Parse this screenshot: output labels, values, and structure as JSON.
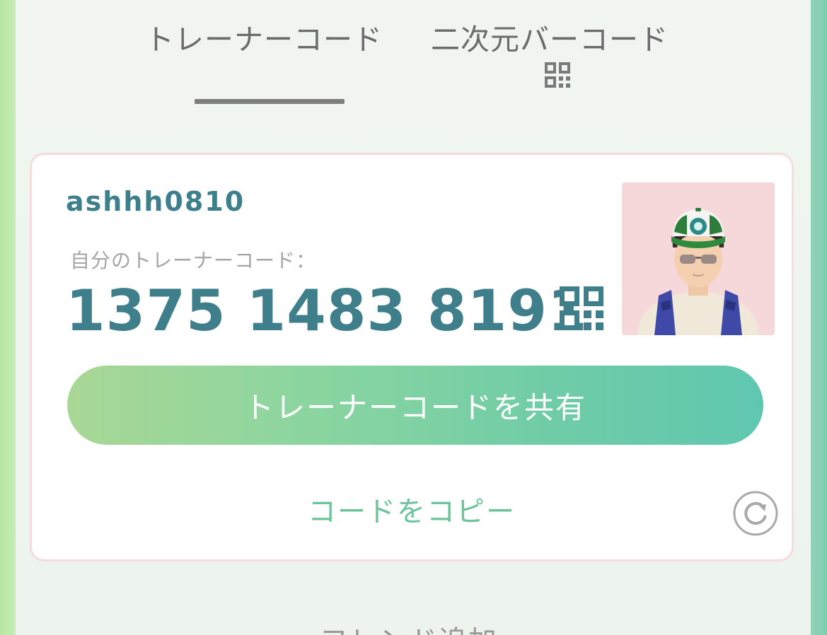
{
  "tabs": [
    {
      "label": "トレーナーコード",
      "selected": true
    },
    {
      "label": "二次元バーコード",
      "icon": "qr-code-icon"
    }
  ],
  "card": {
    "username": "ashhh0810",
    "code_label": "自分のトレーナーコード：",
    "code": "1375 1483 8191",
    "code_icon": "qr-code-icon",
    "avatar": "trainer-avatar",
    "share_button_label": "トレーナーコードを共有",
    "copy_link_label": "コードをコピー",
    "refresh_icon": "refresh-icon"
  },
  "friend_section_label": "フレンド追加",
  "colors": {
    "accent_text": "#3e7f8b",
    "copy_link": "#6cc49b",
    "button_gradient_start": "#a9d795",
    "button_gradient_end": "#5fc7b0",
    "tab_text": "#6b6b6b"
  }
}
